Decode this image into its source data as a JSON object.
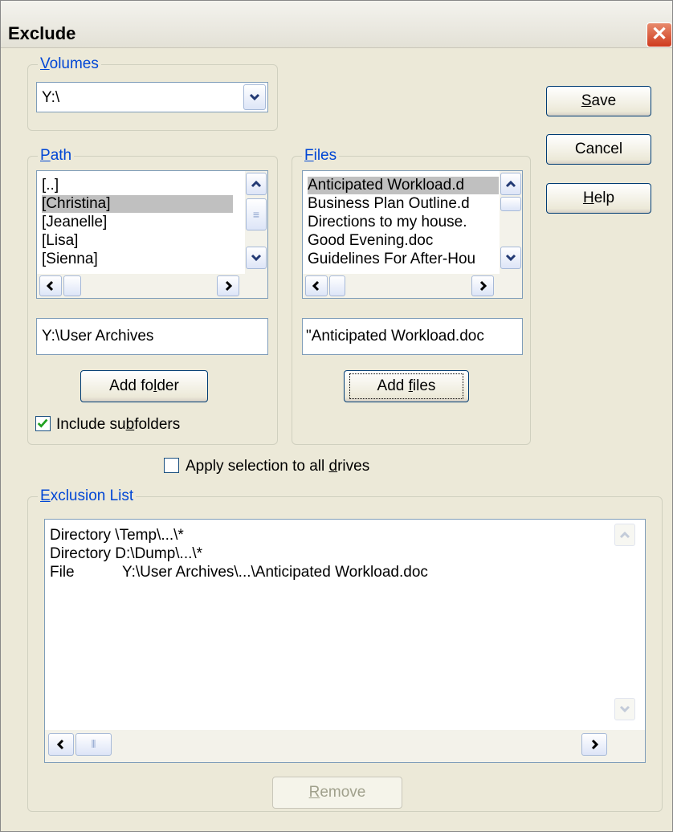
{
  "window": {
    "title": "Exclude"
  },
  "volumes": {
    "legend_prefix": "",
    "legend_access": "V",
    "legend_rest": "olumes",
    "value": "Y:\\"
  },
  "path": {
    "legend_access": "P",
    "legend_rest": "ath",
    "items": [
      "[..]",
      "[Christina]",
      "[Jeanelle]",
      "[Lisa]",
      "[Sienna]"
    ],
    "selected_index": 1,
    "current": "Y:\\User Archives",
    "add_label_pre": "Add fo",
    "add_label_access": "l",
    "add_label_post": "der",
    "include_pre": "Include su",
    "include_access": "b",
    "include_post": "folders",
    "include_checked": true
  },
  "files": {
    "legend_access": "F",
    "legend_rest": "iles",
    "items": [
      "Anticipated Workload.d",
      "Business Plan Outline.d",
      "Directions to my house.",
      "Good Evening.doc",
      "Guidelines For After-Hou"
    ],
    "selected_index": 0,
    "current": "\"Anticipated Workload.doc",
    "add_label_pre": "Add ",
    "add_label_access": "f",
    "add_label_post": "iles"
  },
  "buttons": {
    "save_access": "S",
    "save_rest": "ave",
    "cancel": "Cancel",
    "help_access": "H",
    "help_rest": "elp"
  },
  "apply": {
    "pre": "Apply selection to all ",
    "access": "d",
    "post": "rives",
    "checked": false
  },
  "exclusion": {
    "legend_access": "E",
    "legend_rest": "xclusion List",
    "rows": [
      {
        "type": "Directory",
        "path": "\\Temp\\...\\*"
      },
      {
        "type": "Directory",
        "path": "D:\\Dump\\...\\*"
      },
      {
        "type": "File",
        "path": "Y:\\User Archives\\...\\Anticipated Workload.doc"
      }
    ],
    "remove_access": "R",
    "remove_rest": "emove"
  },
  "colors": {
    "accent": "#0046d5",
    "face": "#ece9d8",
    "border": "#7f9db9",
    "close": "#cf3b1e"
  }
}
